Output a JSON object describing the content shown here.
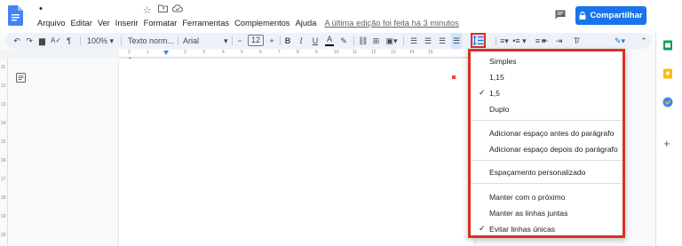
{
  "document": {
    "title": "•"
  },
  "menu": {
    "items": [
      "Arquivo",
      "Editar",
      "Ver",
      "Inserir",
      "Formatar",
      "Ferramentas",
      "Complementos",
      "Ajuda"
    ],
    "last_edit": "A última edição foi feita há 3 minutos"
  },
  "header": {
    "share_label": "Compartilhar"
  },
  "toolbar": {
    "zoom": "100%",
    "style": "Texto norm...",
    "font": "Arial",
    "font_size": "12",
    "bold": "B",
    "italic": "I",
    "underline": "U",
    "text_color": "A",
    "clear": "T̸"
  },
  "ruler": {
    "h_ticks": [
      "2",
      "1",
      "1",
      "2",
      "3",
      "4",
      "5",
      "6",
      "7",
      "8",
      "9",
      "10",
      "11",
      "12",
      "13",
      "14",
      "15"
    ],
    "v_ticks": [
      "11",
      "12",
      "13",
      "14",
      "15",
      "16",
      "17",
      "18",
      "19",
      "20"
    ]
  },
  "line_spacing_menu": {
    "options": [
      {
        "label": "Simples",
        "checked": false
      },
      {
        "label": "1,15",
        "checked": false
      },
      {
        "label": "1,5",
        "checked": true
      },
      {
        "label": "Duplo",
        "checked": false
      }
    ],
    "paragraph_spacing": [
      "Adicionar espaço antes do parágrafo",
      "Adicionar espaço depois do parágrafo"
    ],
    "custom": "Espaçamento personalizado",
    "keep": [
      {
        "label": "Manter com o próximo",
        "checked": false
      },
      {
        "label": "Manter as linhas juntas",
        "checked": false
      },
      {
        "label": "Evitar linhas únicas",
        "checked": true
      }
    ],
    "check_glyph": "✓"
  },
  "colors": {
    "accent": "#1a73e8",
    "highlight": "#d93025",
    "docs_blue": "#4285f4"
  },
  "icons": {
    "logo": "docs-logo-icon",
    "star": "star-icon",
    "folder": "folder-icon",
    "cloud": "cloud-icon",
    "comment": "comment-icon",
    "lock": "lock-icon",
    "outline": "outline-icon"
  }
}
